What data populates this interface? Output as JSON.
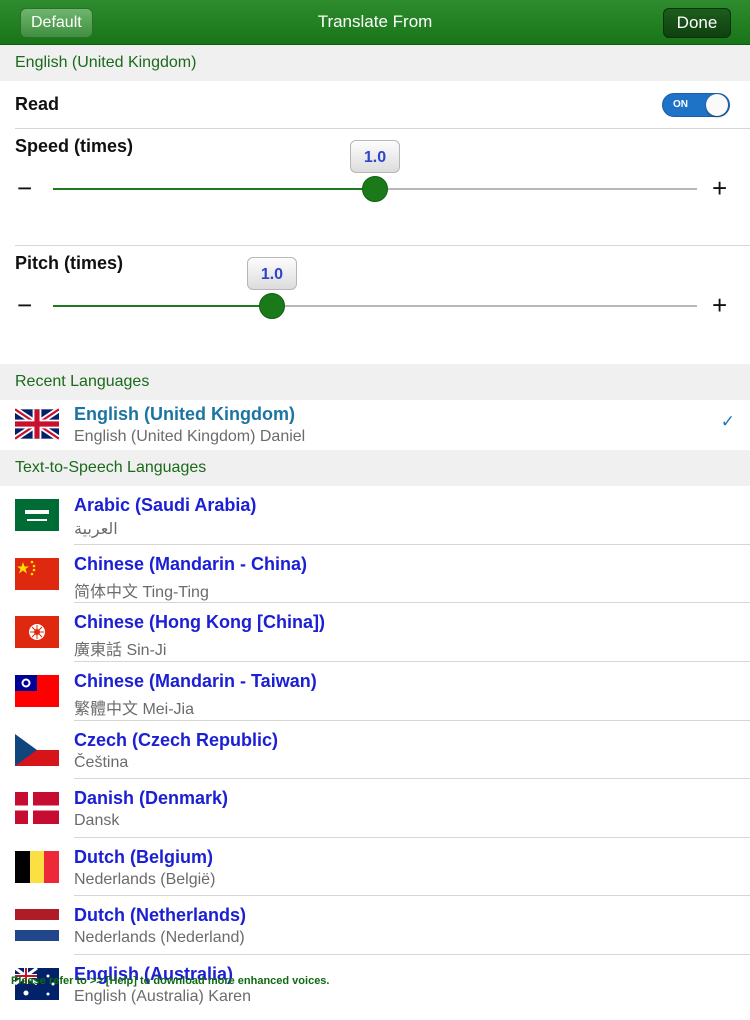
{
  "header": {
    "title": "Translate From",
    "default_label": "Default",
    "done_label": "Done"
  },
  "section_current": "English (United Kingdom)",
  "read": {
    "label": "Read",
    "toggle_label": "ON",
    "on": true
  },
  "speed": {
    "label": "Speed (times)",
    "value": "1.0",
    "level": 0.5,
    "minus": "−",
    "plus": "+"
  },
  "pitch": {
    "label": "Pitch (times)",
    "value": "1.0",
    "level": 0.34,
    "minus": "−",
    "plus": "+"
  },
  "section_recent": "Recent Languages",
  "recent": {
    "name": "English (United Kingdom)",
    "sub": "English (United Kingdom) Daniel",
    "check": "✓"
  },
  "section_tts": "Text-to-Speech Languages",
  "languages": [
    {
      "name": "Arabic (Saudi Arabia)",
      "sub": "العربية",
      "flag": "sa-flag-icon"
    },
    {
      "name": "Chinese (Mandarin - China)",
      "sub": "简体中文 Ting-Ting",
      "flag": "cn-flag-icon"
    },
    {
      "name": "Chinese (Hong Kong [China])",
      "sub": "廣東話 Sin-Ji",
      "flag": "hk-flag-icon"
    },
    {
      "name": "Chinese (Mandarin - Taiwan)",
      "sub": "繁體中文 Mei-Jia",
      "flag": "tw-flag-icon"
    },
    {
      "name": "Czech (Czech Republic)",
      "sub": "Čeština",
      "flag": "cz-flag-icon"
    },
    {
      "name": "Danish (Denmark)",
      "sub": "Dansk",
      "flag": "dk-flag-icon"
    },
    {
      "name": "Dutch (Belgium)",
      "sub": "Nederlands (België)",
      "flag": "be-flag-icon"
    },
    {
      "name": "Dutch (Netherlands)",
      "sub": "Nederlands (Nederland)",
      "flag": "nl-flag-icon"
    },
    {
      "name": "English (Australia)",
      "sub": "English (Australia) Karen",
      "flag": "au-flag-icon"
    }
  ],
  "footer_note": "Please refer to >> [Help] to download more enhanced voices.",
  "colors": {
    "accent": "#1f7a1f",
    "nav": "#187518",
    "link": "#1c20d4",
    "toggle": "#1f73c6"
  }
}
